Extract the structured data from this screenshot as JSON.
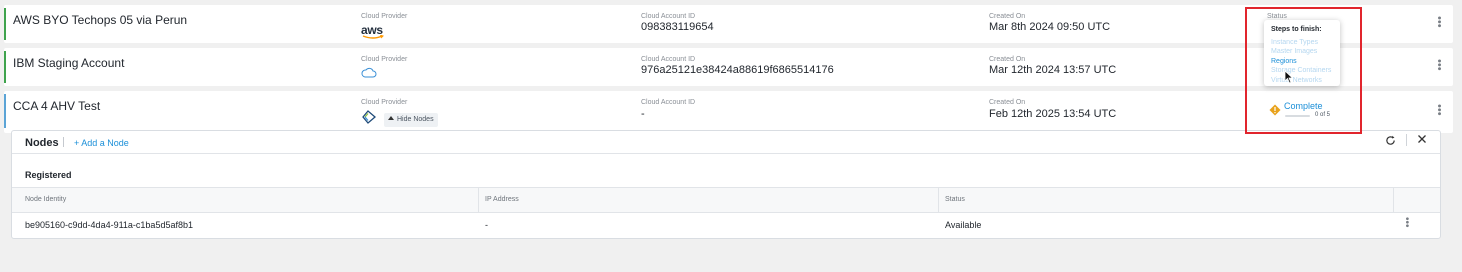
{
  "accounts": [
    {
      "name": "AWS BYO Techops 05 via Perun",
      "accent_color": "#3fa34d",
      "provider_label": "Cloud Provider",
      "provider_logo_text": "aws",
      "provider_icon": "aws-logo",
      "account_id_label": "Cloud Account ID",
      "account_id": "098383119654",
      "created_label": "Created On",
      "created_on": "Mar 8th 2024 09:50 UTC",
      "status_label": "Status"
    },
    {
      "name": "IBM Staging Account",
      "accent_color": "#3fa34d",
      "provider_label": "Cloud Provider",
      "provider_icon": "cloud-icon",
      "account_id_label": "Cloud Account ID",
      "account_id": "976a25121e38424a88619f6865514176",
      "created_label": "Created On",
      "created_on": "Mar 12th 2024 13:57 UTC"
    },
    {
      "name": "CCA 4 AHV Test",
      "accent_color": "#5ba4d6",
      "provider_label": "Cloud Provider",
      "provider_icon": "nutanix-logo",
      "hide_nodes_label": "Hide Nodes",
      "account_id_label": "Cloud Account ID",
      "account_id": "-",
      "created_label": "Created On",
      "created_on": "Feb 12th 2025 13:54 UTC",
      "status_link": "Complete",
      "status_icon": "warning-diamond-icon",
      "progress_text": "0 of 5",
      "progress_fraction": 0
    }
  ],
  "popover": {
    "title": "Steps to finish:",
    "steps": [
      {
        "label": "Instance Types",
        "state": "faded"
      },
      {
        "label": "Master Images",
        "state": "faded"
      },
      {
        "label": "Regions",
        "state": "active"
      },
      {
        "label": "Storage Containers",
        "state": "faded"
      },
      {
        "label": "Virtual Networks",
        "state": "faded"
      }
    ]
  },
  "nodes": {
    "title": "Nodes",
    "add_label": "+ Add a Node",
    "section_title": "Registered",
    "columns": [
      "Node Identity",
      "IP Address",
      "Status"
    ],
    "rows": [
      [
        "be905160-c9dd-4da4-911a-c1ba5d5af8b1",
        "-",
        "Available"
      ]
    ]
  },
  "colors": {
    "link": "#1b8fd8",
    "highlight": "#e1252d",
    "warning": "#e8a21c"
  }
}
